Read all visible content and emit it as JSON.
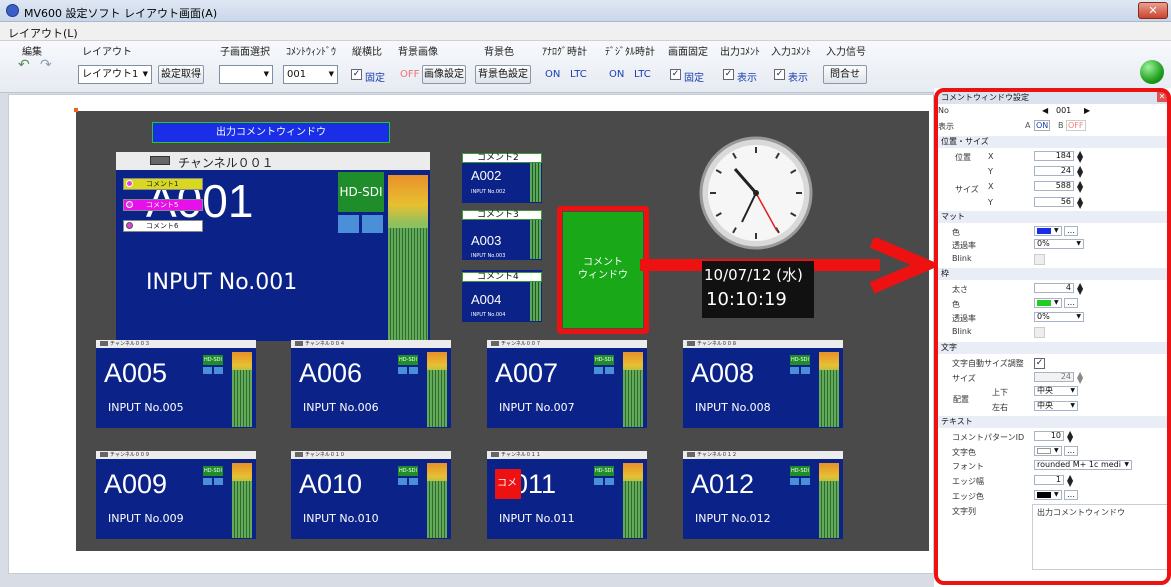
{
  "window": {
    "title": "MV600 設定ソフト レイアウト画面(A)",
    "close": "✕"
  },
  "menu": {
    "layout": "レイアウト(L)"
  },
  "toolbar": {
    "edit": {
      "label": "編集",
      "undo": "↶",
      "redo": "↷"
    },
    "layout": {
      "label": "レイアウト",
      "value": "レイアウト1",
      "button": "設定取得"
    },
    "subscreen": {
      "label": "子画面選択",
      "value": ""
    },
    "comment_window": {
      "label": "ｺﾒﾝﾄｳｨﾝﾄﾞｳ",
      "value": "001"
    },
    "aspect": {
      "label": "縦横比",
      "check": "✓",
      "text": "固定"
    },
    "bg_image": {
      "label": "背景画像",
      "off": "OFF",
      "button": "画像設定"
    },
    "bg_color": {
      "label": "背景色",
      "button": "背景色設定"
    },
    "analog_clock": {
      "label": "ｱﾅﾛｸﾞ時計",
      "on": "ON",
      "ltc": "LTC"
    },
    "digital_clock": {
      "label": "ﾃﾞｼﾞﾀﾙ時計",
      "on": "ON",
      "ltc": "LTC"
    },
    "screen_lock": {
      "label": "画面固定",
      "check": "✓",
      "text": "固定"
    },
    "output_comment": {
      "label": "出力ｺﾒﾝﾄ",
      "check": "✓",
      "text": "表示"
    },
    "input_comment": {
      "label": "入力ｺﾒﾝﾄ",
      "check": "✓",
      "text": "表示"
    },
    "input_signal": {
      "label": "入力信号",
      "button": "問合せ"
    }
  },
  "canvas": {
    "output_comment": "出力コメントウィンドウ",
    "main": {
      "header": "チャンネル００１",
      "name": "A001",
      "input": "INPUT No.001",
      "hdsdi": "HD-SDI",
      "c1": "コメント1",
      "c5": "コメント5",
      "c6": "コメント6"
    },
    "small": [
      {
        "comment": "コメント2",
        "name": "A002",
        "input": "INPUT No.002"
      },
      {
        "comment": "コメント3",
        "name": "A003",
        "input": "INPUT No.003"
      },
      {
        "comment": "コメント4",
        "name": "A004",
        "input": "INPUT No.004"
      }
    ],
    "comment_window": "コメント\nウィンドウ",
    "digital_date": "10/07/12 (水)",
    "digital_time": "10:10:19",
    "channels": [
      {
        "header": "チャンネル００３",
        "name": "A005",
        "input": "INPUT No.005"
      },
      {
        "header": "チャンネル００４",
        "name": "A006",
        "input": "INPUT No.006"
      },
      {
        "header": "チャンネル００７",
        "name": "A007",
        "input": "INPUT No.007"
      },
      {
        "header": "チャンネル００８",
        "name": "A008",
        "input": "INPUT No.008"
      },
      {
        "header": "チャンネル００９",
        "name": "A009",
        "input": "INPUT No.009"
      },
      {
        "header": "チャンネル０１０",
        "name": "A010",
        "input": "INPUT No.010"
      },
      {
        "header": "チャンネル０１１",
        "name": "A011",
        "input": "INPUT No.011"
      },
      {
        "header": "チャンネル０１２",
        "name": "A012",
        "input": "INPUT No.012"
      }
    ],
    "hdsdi": "HD-SDI",
    "a011_comment": "コメ"
  },
  "panel": {
    "title": "コメントウィンドウ設定",
    "no_label": "No",
    "no_value": "001",
    "display_label": "表示",
    "display_a": "A",
    "display_on": "ON",
    "display_b": "B",
    "display_off": "OFF",
    "pos_size": "位置・サイズ",
    "position": "位置",
    "size": "サイズ",
    "x": "X",
    "y": "Y",
    "pos_x": "184",
    "pos_y": "24",
    "size_x": "588",
    "size_y": "56",
    "matte": "マット",
    "color": "色",
    "transparency": "透過率",
    "matte_transparency": "0%",
    "blink": "Blink",
    "frame": "枠",
    "thickness": "太さ",
    "frame_thickness": "4",
    "frame_transparency": "0%",
    "text_sec": "文字",
    "auto_size": "文字自動サイズ調整",
    "text_size_label": "サイズ",
    "text_size": "24",
    "layout_label": "配置",
    "vertical": "上下",
    "horizontal": "左右",
    "center": "中央",
    "text": "テキスト",
    "pattern_label": "コメントパターンID",
    "pattern": "10",
    "text_color": "文字色",
    "font_label": "フォント",
    "font": "rounded M+ 1c medi",
    "edge_width_label": "エッジ幅",
    "edge_width": "1",
    "edge_color": "エッジ色",
    "string_label": "文字列",
    "string": "出力コメントウィンドウ",
    "colors": {
      "matte": "#1a2ee8",
      "frame": "#22cc22",
      "text": "#ffffff",
      "edge": "#000000"
    }
  }
}
